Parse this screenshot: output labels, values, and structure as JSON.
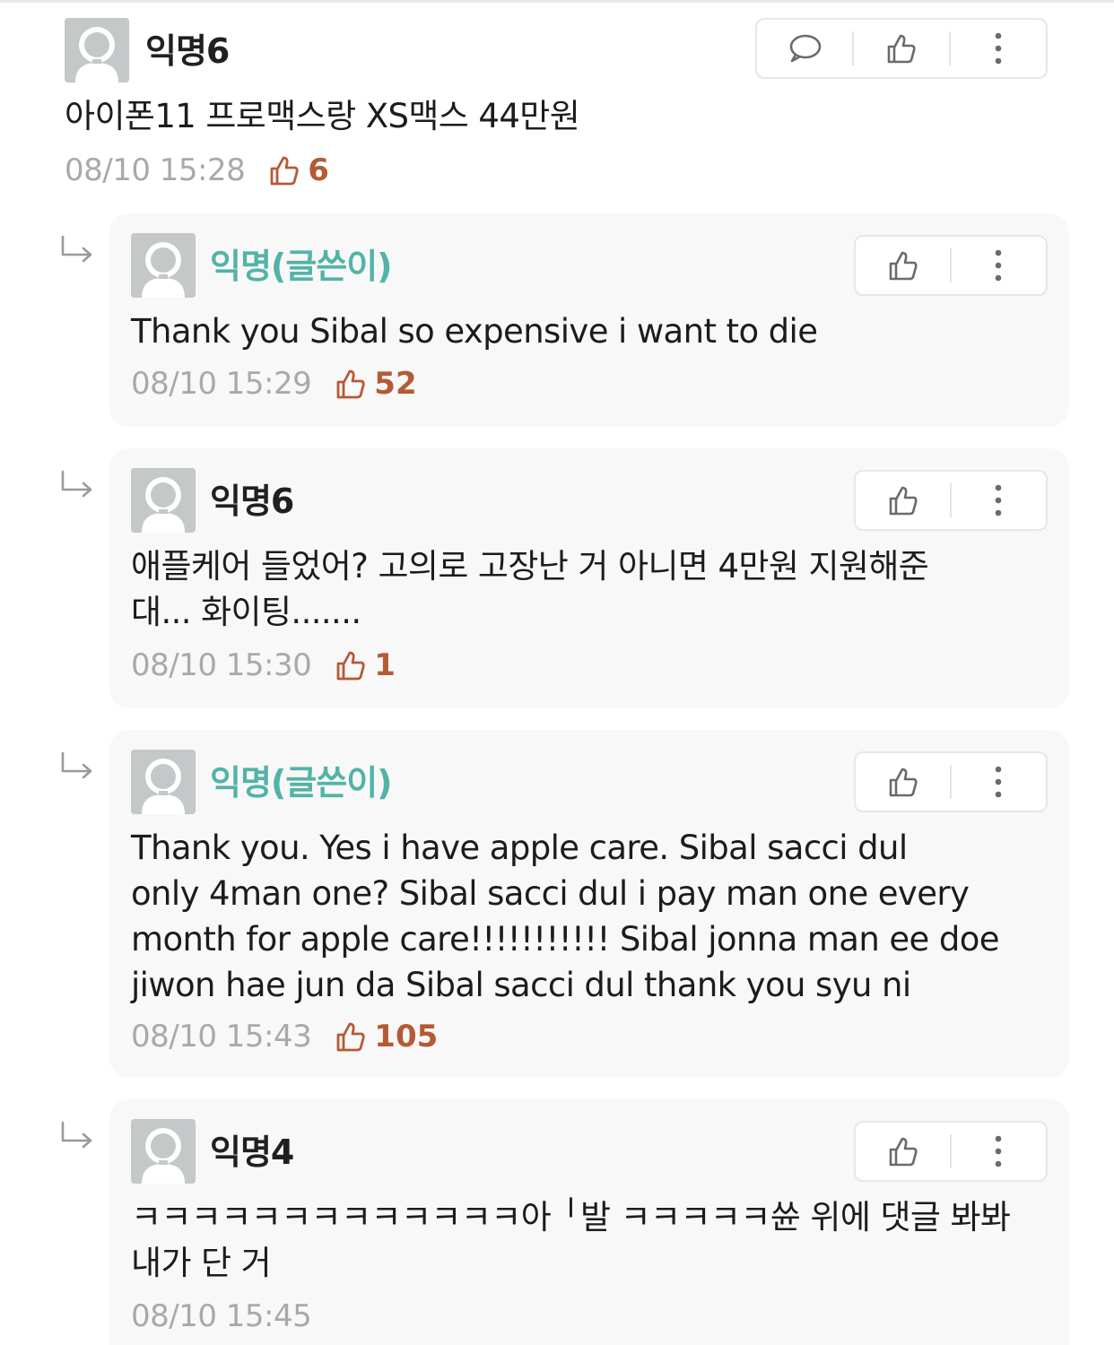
{
  "colors": {
    "op_name": "#52b3a7",
    "like_count": "#b65a36",
    "timestamp": "#a9a9a9",
    "reply_bg": "#f8f8f8"
  },
  "comment": {
    "author": "익명6",
    "text": "아이폰11 프로맥스랑 XS맥스 44만원",
    "time": "08/10 15:28",
    "likes": "6",
    "actions": [
      "comment-icon",
      "thumbs-up-icon",
      "more-vertical-icon"
    ]
  },
  "replies": [
    {
      "author": "익명(글쓴이)",
      "is_op": true,
      "lines": [
        "Thank you Sibal so expensive i want to die"
      ],
      "time": "08/10 15:29",
      "likes": "52"
    },
    {
      "author": "익명6",
      "is_op": false,
      "lines": [
        "애플케어 들었어? 고의로 고장난 거 아니면 4만원 지원해준",
        "대... 화이팅......."
      ],
      "time": "08/10 15:30",
      "likes": "1"
    },
    {
      "author": "익명(글쓴이)",
      "is_op": true,
      "lines": [
        "Thank you. Yes i have apple care. Sibal sacci dul",
        "only 4man one? Sibal sacci dul i pay man one every",
        "month for apple care!!!!!!!!!!! Sibal jonna man ee doe",
        "jiwon hae jun da Sibal sacci dul thank you syu ni"
      ],
      "time": "08/10 15:43",
      "likes": "105"
    },
    {
      "author": "익명4",
      "is_op": false,
      "lines": [
        "ㅋㅋㅋㅋㅋㅋㅋㅋㅋㅋㅋㅋㅋ아 ╵발 ㅋㅋㅋㅋㅋ쓘 위에 댓글 봐봐",
        "내가 단 거"
      ],
      "time": "08/10 15:45",
      "likes": ""
    }
  ]
}
